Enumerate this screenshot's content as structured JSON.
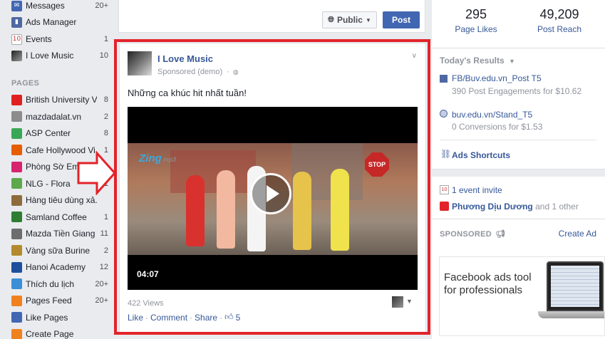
{
  "sidebar": {
    "items_top": [
      {
        "label": "Messages",
        "count": "20+",
        "icon": "messages-icon",
        "color": "#4267b2"
      },
      {
        "label": "Ads Manager",
        "count": "",
        "icon": "ads-manager-icon",
        "color": "#4e69a2"
      },
      {
        "label": "Events",
        "count": "1",
        "icon": "events-icon",
        "color": "#e9ebee"
      },
      {
        "label": "I Love Music",
        "count": "10",
        "icon": "page-icon",
        "color": "#555555"
      }
    ],
    "pages_header": "PAGES",
    "pages": [
      {
        "label": "British University Vi...",
        "count": "8",
        "icon": "page-icon",
        "color": "#e02020"
      },
      {
        "label": "mazdadalat.vn",
        "count": "2",
        "icon": "page-icon",
        "color": "#8c8c8c"
      },
      {
        "label": "ASP Center",
        "count": "8",
        "icon": "page-icon",
        "color": "#3aa757"
      },
      {
        "label": "Cafe Hollywood Vi...",
        "count": "1",
        "icon": "page-icon",
        "color": "#e65c00"
      },
      {
        "label": "Phòng Sờ Em",
        "count": "",
        "icon": "page-icon",
        "color": "#d6246e"
      },
      {
        "label": "NLG - Flora",
        "count": "1",
        "icon": "page-icon",
        "color": "#5ca84a"
      },
      {
        "label": "Hàng tiêu dùng xả...",
        "count": "",
        "icon": "page-icon",
        "color": "#8e6b3c"
      },
      {
        "label": "Samland Coffee",
        "count": "1",
        "icon": "page-icon",
        "color": "#2e7d32"
      },
      {
        "label": "Mazda Tiền Giang",
        "count": "11",
        "icon": "page-icon",
        "color": "#6d6d6d"
      },
      {
        "label": "Vàng sữa Burine",
        "count": "2",
        "icon": "page-icon",
        "color": "#b38b2e"
      },
      {
        "label": "Hanoi Academy",
        "count": "12",
        "icon": "page-icon",
        "color": "#1e4f9c"
      },
      {
        "label": "Thích du lịch",
        "count": "20+",
        "icon": "page-icon",
        "color": "#3b8ed8"
      },
      {
        "label": "Pages Feed",
        "count": "20+",
        "icon": "pages-feed-icon",
        "color": "#f0821e"
      },
      {
        "label": "Like Pages",
        "count": "",
        "icon": "like-pages-icon",
        "color": "#4267b2"
      },
      {
        "label": "Create Page",
        "count": "",
        "icon": "create-page-icon",
        "color": "#f0821e"
      }
    ]
  },
  "composer": {
    "audience_label": "Public",
    "post_label": "Post"
  },
  "post": {
    "page_name": "I Love Music",
    "sponsored_label": "Sponsored (demo)",
    "text": "Những ca khúc hit nhất tuần!",
    "video_brand": "Zing",
    "video_brand_suffix": "mp3",
    "stop_sign": "STOP",
    "duration": "04:07",
    "views": "422 Views",
    "actions": {
      "like": "Like",
      "comment": "Comment",
      "share": "Share",
      "like_count": "5"
    }
  },
  "right": {
    "stats": [
      {
        "value": "295",
        "label": "Page Likes"
      },
      {
        "value": "49,209",
        "label": "Post Reach"
      }
    ],
    "results_title": "Today's Results",
    "results": [
      {
        "link": "FB/Buv.edu.vn_Post T5",
        "sub": "390 Post Engagements for $10.62"
      },
      {
        "link": "buv.edu.vn/Stand_T5",
        "sub": "0 Conversions for $1.53"
      }
    ],
    "ads_shortcuts": "Ads Shortcuts",
    "event_invite": "1 event invite",
    "birthday_name": "Phương Dịu Dương",
    "birthday_rest": "and 1 other",
    "sponsored_title": "SPONSORED",
    "create_ad": "Create Ad",
    "ad_text": "Facebook ads tool for professionals"
  },
  "colors": {
    "highlight_frame": "#e2232a",
    "link": "#365899",
    "primary_button": "#4267b2"
  }
}
